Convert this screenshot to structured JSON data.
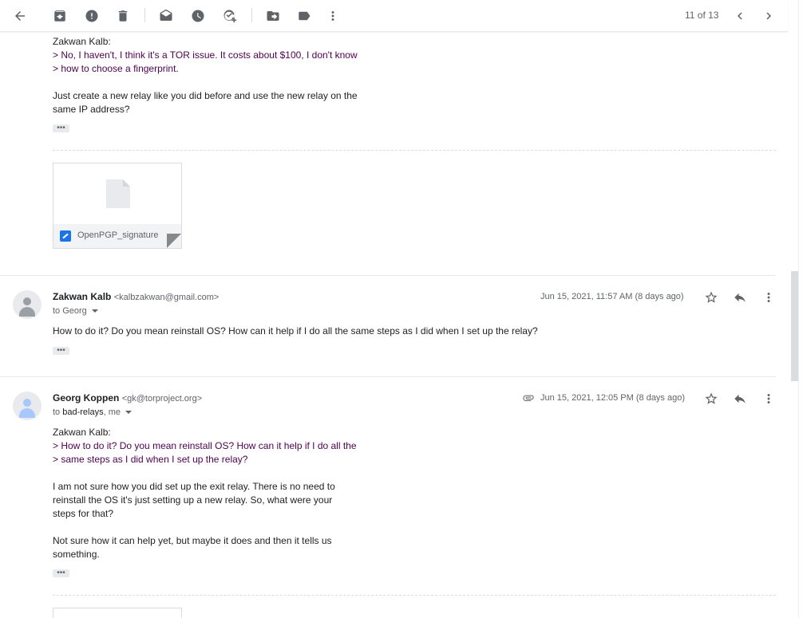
{
  "toolbar": {
    "pager": "11 of 13"
  },
  "msg1": {
    "lines": [
      {
        "text": "Zakwan Kalb:",
        "quote": false
      },
      {
        "text": "> No, I haven't, I think it's a TOR issue. It costs about $100, I don't know",
        "quote": true
      },
      {
        "text": "> how to choose a fingerprint.",
        "quote": true
      },
      {
        "text": "",
        "quote": false
      },
      {
        "text": "Just create a new relay like you did before and use the new relay on the",
        "quote": false
      },
      {
        "text": "same IP address?",
        "quote": false
      }
    ],
    "attachment": "OpenPGP_signature"
  },
  "msg2": {
    "sender_name": "Zakwan Kalb",
    "sender_email": "<kalbzakwan@gmail.com>",
    "to": "to Georg",
    "date": "Jun 15, 2021, 11:57 AM (8 days ago)",
    "body": "How to do it? Do you mean reinstall OS? How can it help if I do all the same steps as I did when I set up the relay?"
  },
  "msg3": {
    "sender_name": "Georg Koppen",
    "sender_email": "<gk@torproject.org>",
    "to_prefix": "to ",
    "to_main": "bad-relays",
    "to_rest": ", me",
    "date": "Jun 15, 2021, 12:05 PM (8 days ago)",
    "lines": [
      {
        "text": "Zakwan Kalb:",
        "quote": false
      },
      {
        "text": "> How to do it? Do you mean reinstall OS? How can it help if I do all the",
        "quote": true
      },
      {
        "text": "> same steps as I did when I set up the relay?",
        "quote": true
      },
      {
        "text": "",
        "quote": false
      },
      {
        "text": "I am not sure how you did set up the exit relay. There is no need to",
        "quote": false
      },
      {
        "text": "reinstall the OS it's just setting up a new relay. So, what were your",
        "quote": false
      },
      {
        "text": "steps for that?",
        "quote": false
      },
      {
        "text": "",
        "quote": false
      },
      {
        "text": "Not sure how it can help yet, but maybe it does and then it tells us",
        "quote": false
      },
      {
        "text": "something.",
        "quote": false
      }
    ]
  },
  "icons": {
    "toolbar": [
      "back-arrow-icon",
      "archive-icon",
      "report-spam-icon",
      "delete-icon",
      "mark-unread-icon",
      "snooze-icon",
      "add-to-tasks-icon",
      "move-to-icon",
      "label-icon",
      "more-vert-icon",
      "chevron-left-icon",
      "chevron-right-icon"
    ],
    "message": [
      "star-icon",
      "reply-icon",
      "more-vert-icon",
      "attachment-clip-icon"
    ]
  },
  "colors": {
    "quote": "#500050",
    "text": "#222222",
    "meta": "#5f6368"
  }
}
